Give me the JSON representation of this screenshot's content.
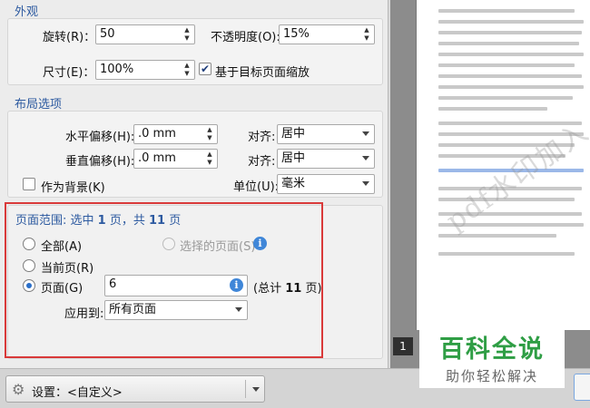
{
  "appearance": {
    "section_title": "外观",
    "rotation_label": "旋转(R)：",
    "rotation_value": "50",
    "opacity_label": "不透明度(O):",
    "opacity_value": "15%",
    "size_label": "尺寸(E)：",
    "size_value": "100%",
    "scale_checkbox_label": "基于目标页面缩放",
    "scale_checked": true
  },
  "layout": {
    "section_title": "布局选项",
    "h_offset_label": "水平偏移(H):",
    "h_offset_value": ".0 mm",
    "v_offset_label": "垂直偏移(H):",
    "v_offset_value": ".0 mm",
    "align_label": "对齐:",
    "h_align_value": "居中",
    "v_align_value": "居中",
    "background_checkbox_label": "作为背景(K)",
    "unit_label": "单位(U):",
    "unit_value": "毫米"
  },
  "page_range": {
    "title_prefix": "页面范围: 选中 ",
    "selected_count": "1",
    "title_mid": " 页，共 ",
    "total_count": "11",
    "title_suffix": " 页",
    "all_label": "全部(A)",
    "selected_pages_label": "选择的页面(S)",
    "current_page_label": "当前页(R)",
    "pages_label": "页面(G)",
    "pages_value": "6",
    "total_prefix": "(总计 ",
    "total_value": "11",
    "total_suffix": " 页)",
    "apply_to_label": "应用到:",
    "apply_to_value": "所有页面"
  },
  "bottom": {
    "settings_label": "设置：<自定义>"
  },
  "preview": {
    "page_number": "1",
    "watermark_text": "pdf水印加入"
  },
  "brand": {
    "title": "百科全说",
    "subtitle": "助你轻松解决"
  },
  "colors": {
    "highlight": "#d93a3a",
    "section_title": "#2d5aa0",
    "brand_green": "#2f9e45",
    "info_blue": "#3f86d8"
  }
}
